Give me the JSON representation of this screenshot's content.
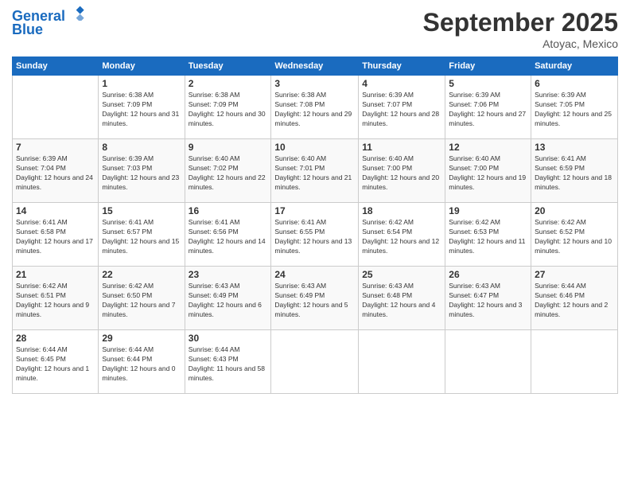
{
  "header": {
    "logo_line1": "General",
    "logo_line2": "Blue",
    "month": "September 2025",
    "location": "Atoyac, Mexico"
  },
  "days_of_week": [
    "Sunday",
    "Monday",
    "Tuesday",
    "Wednesday",
    "Thursday",
    "Friday",
    "Saturday"
  ],
  "weeks": [
    [
      {
        "day": "",
        "sunrise": "",
        "sunset": "",
        "daylight": ""
      },
      {
        "day": "1",
        "sunrise": "Sunrise: 6:38 AM",
        "sunset": "Sunset: 7:09 PM",
        "daylight": "Daylight: 12 hours and 31 minutes."
      },
      {
        "day": "2",
        "sunrise": "Sunrise: 6:38 AM",
        "sunset": "Sunset: 7:09 PM",
        "daylight": "Daylight: 12 hours and 30 minutes."
      },
      {
        "day": "3",
        "sunrise": "Sunrise: 6:38 AM",
        "sunset": "Sunset: 7:08 PM",
        "daylight": "Daylight: 12 hours and 29 minutes."
      },
      {
        "day": "4",
        "sunrise": "Sunrise: 6:39 AM",
        "sunset": "Sunset: 7:07 PM",
        "daylight": "Daylight: 12 hours and 28 minutes."
      },
      {
        "day": "5",
        "sunrise": "Sunrise: 6:39 AM",
        "sunset": "Sunset: 7:06 PM",
        "daylight": "Daylight: 12 hours and 27 minutes."
      },
      {
        "day": "6",
        "sunrise": "Sunrise: 6:39 AM",
        "sunset": "Sunset: 7:05 PM",
        "daylight": "Daylight: 12 hours and 25 minutes."
      }
    ],
    [
      {
        "day": "7",
        "sunrise": "Sunrise: 6:39 AM",
        "sunset": "Sunset: 7:04 PM",
        "daylight": "Daylight: 12 hours and 24 minutes."
      },
      {
        "day": "8",
        "sunrise": "Sunrise: 6:39 AM",
        "sunset": "Sunset: 7:03 PM",
        "daylight": "Daylight: 12 hours and 23 minutes."
      },
      {
        "day": "9",
        "sunrise": "Sunrise: 6:40 AM",
        "sunset": "Sunset: 7:02 PM",
        "daylight": "Daylight: 12 hours and 22 minutes."
      },
      {
        "day": "10",
        "sunrise": "Sunrise: 6:40 AM",
        "sunset": "Sunset: 7:01 PM",
        "daylight": "Daylight: 12 hours and 21 minutes."
      },
      {
        "day": "11",
        "sunrise": "Sunrise: 6:40 AM",
        "sunset": "Sunset: 7:00 PM",
        "daylight": "Daylight: 12 hours and 20 minutes."
      },
      {
        "day": "12",
        "sunrise": "Sunrise: 6:40 AM",
        "sunset": "Sunset: 7:00 PM",
        "daylight": "Daylight: 12 hours and 19 minutes."
      },
      {
        "day": "13",
        "sunrise": "Sunrise: 6:41 AM",
        "sunset": "Sunset: 6:59 PM",
        "daylight": "Daylight: 12 hours and 18 minutes."
      }
    ],
    [
      {
        "day": "14",
        "sunrise": "Sunrise: 6:41 AM",
        "sunset": "Sunset: 6:58 PM",
        "daylight": "Daylight: 12 hours and 17 minutes."
      },
      {
        "day": "15",
        "sunrise": "Sunrise: 6:41 AM",
        "sunset": "Sunset: 6:57 PM",
        "daylight": "Daylight: 12 hours and 15 minutes."
      },
      {
        "day": "16",
        "sunrise": "Sunrise: 6:41 AM",
        "sunset": "Sunset: 6:56 PM",
        "daylight": "Daylight: 12 hours and 14 minutes."
      },
      {
        "day": "17",
        "sunrise": "Sunrise: 6:41 AM",
        "sunset": "Sunset: 6:55 PM",
        "daylight": "Daylight: 12 hours and 13 minutes."
      },
      {
        "day": "18",
        "sunrise": "Sunrise: 6:42 AM",
        "sunset": "Sunset: 6:54 PM",
        "daylight": "Daylight: 12 hours and 12 minutes."
      },
      {
        "day": "19",
        "sunrise": "Sunrise: 6:42 AM",
        "sunset": "Sunset: 6:53 PM",
        "daylight": "Daylight: 12 hours and 11 minutes."
      },
      {
        "day": "20",
        "sunrise": "Sunrise: 6:42 AM",
        "sunset": "Sunset: 6:52 PM",
        "daylight": "Daylight: 12 hours and 10 minutes."
      }
    ],
    [
      {
        "day": "21",
        "sunrise": "Sunrise: 6:42 AM",
        "sunset": "Sunset: 6:51 PM",
        "daylight": "Daylight: 12 hours and 9 minutes."
      },
      {
        "day": "22",
        "sunrise": "Sunrise: 6:42 AM",
        "sunset": "Sunset: 6:50 PM",
        "daylight": "Daylight: 12 hours and 7 minutes."
      },
      {
        "day": "23",
        "sunrise": "Sunrise: 6:43 AM",
        "sunset": "Sunset: 6:49 PM",
        "daylight": "Daylight: 12 hours and 6 minutes."
      },
      {
        "day": "24",
        "sunrise": "Sunrise: 6:43 AM",
        "sunset": "Sunset: 6:49 PM",
        "daylight": "Daylight: 12 hours and 5 minutes."
      },
      {
        "day": "25",
        "sunrise": "Sunrise: 6:43 AM",
        "sunset": "Sunset: 6:48 PM",
        "daylight": "Daylight: 12 hours and 4 minutes."
      },
      {
        "day": "26",
        "sunrise": "Sunrise: 6:43 AM",
        "sunset": "Sunset: 6:47 PM",
        "daylight": "Daylight: 12 hours and 3 minutes."
      },
      {
        "day": "27",
        "sunrise": "Sunrise: 6:44 AM",
        "sunset": "Sunset: 6:46 PM",
        "daylight": "Daylight: 12 hours and 2 minutes."
      }
    ],
    [
      {
        "day": "28",
        "sunrise": "Sunrise: 6:44 AM",
        "sunset": "Sunset: 6:45 PM",
        "daylight": "Daylight: 12 hours and 1 minute."
      },
      {
        "day": "29",
        "sunrise": "Sunrise: 6:44 AM",
        "sunset": "Sunset: 6:44 PM",
        "daylight": "Daylight: 12 hours and 0 minutes."
      },
      {
        "day": "30",
        "sunrise": "Sunrise: 6:44 AM",
        "sunset": "Sunset: 6:43 PM",
        "daylight": "Daylight: 11 hours and 58 minutes."
      },
      {
        "day": "",
        "sunrise": "",
        "sunset": "",
        "daylight": ""
      },
      {
        "day": "",
        "sunrise": "",
        "sunset": "",
        "daylight": ""
      },
      {
        "day": "",
        "sunrise": "",
        "sunset": "",
        "daylight": ""
      },
      {
        "day": "",
        "sunrise": "",
        "sunset": "",
        "daylight": ""
      }
    ]
  ]
}
